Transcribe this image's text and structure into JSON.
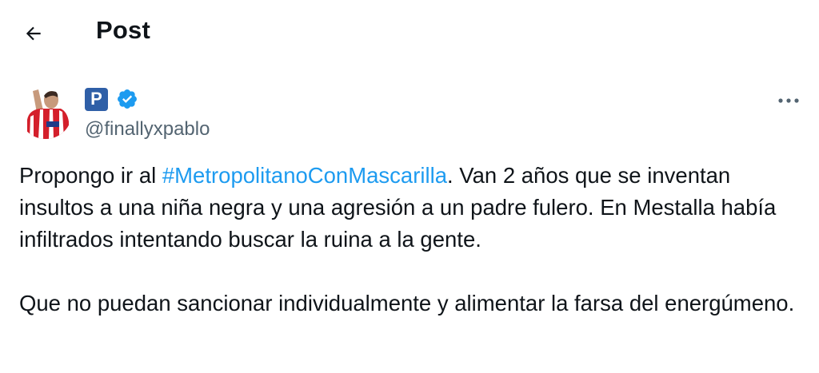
{
  "header": {
    "title": "Post",
    "back_icon": "arrow-left-icon"
  },
  "author": {
    "badge_letter": "P",
    "verified_icon": "verified-badge-icon",
    "handle": "@finallyxpablo"
  },
  "more_icon": "more-horizontal-icon",
  "post": {
    "p1_before": "Propongo ir al ",
    "hashtag": "#MetropolitanoConMascarilla",
    "p1_after": ". Van 2 años que se inventan insultos a una niña negra y una agresión a un padre fulero. En Mestalla había infiltrados intentando buscar la ruina a la gente.",
    "p2": "Que no puedan sancionar individualmente y alimentar la farsa del energúmeno."
  },
  "colors": {
    "text": "#0f1419",
    "secondary": "#536471",
    "accent": "#1d9bf0",
    "badge_bg": "#2f5fa7"
  }
}
